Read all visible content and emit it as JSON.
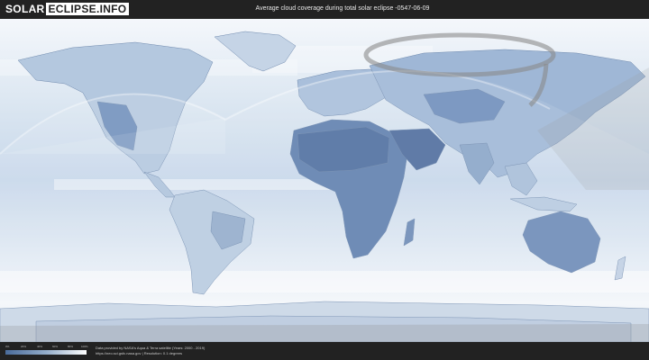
{
  "header": {
    "logo_part1": "SOLAR",
    "logo_part2": "ECLIPSE.INFO",
    "title": "Average cloud coverage during total solar eclipse -0547-06-09"
  },
  "legend": {
    "ticks": [
      "0%",
      "20%",
      "40%",
      "60%",
      "80%",
      "100%"
    ],
    "colors": {
      "low": "#4a6c9c",
      "mid": "#93acc9",
      "high": "#ffffff"
    }
  },
  "credits": {
    "line1": "Data provided by NASA's Aqua & Terra satellite (Years: 2000 - 2019)",
    "line2": "https://neo.sci.gsfc.nasa.gov | Resolution: 0.1 degrees"
  },
  "map": {
    "name": "cloud-coverage-world-map",
    "ocean_color": "#dde8f3",
    "land_color": "#7d98bd",
    "eclipse_band_color": "#8a8a8a"
  }
}
